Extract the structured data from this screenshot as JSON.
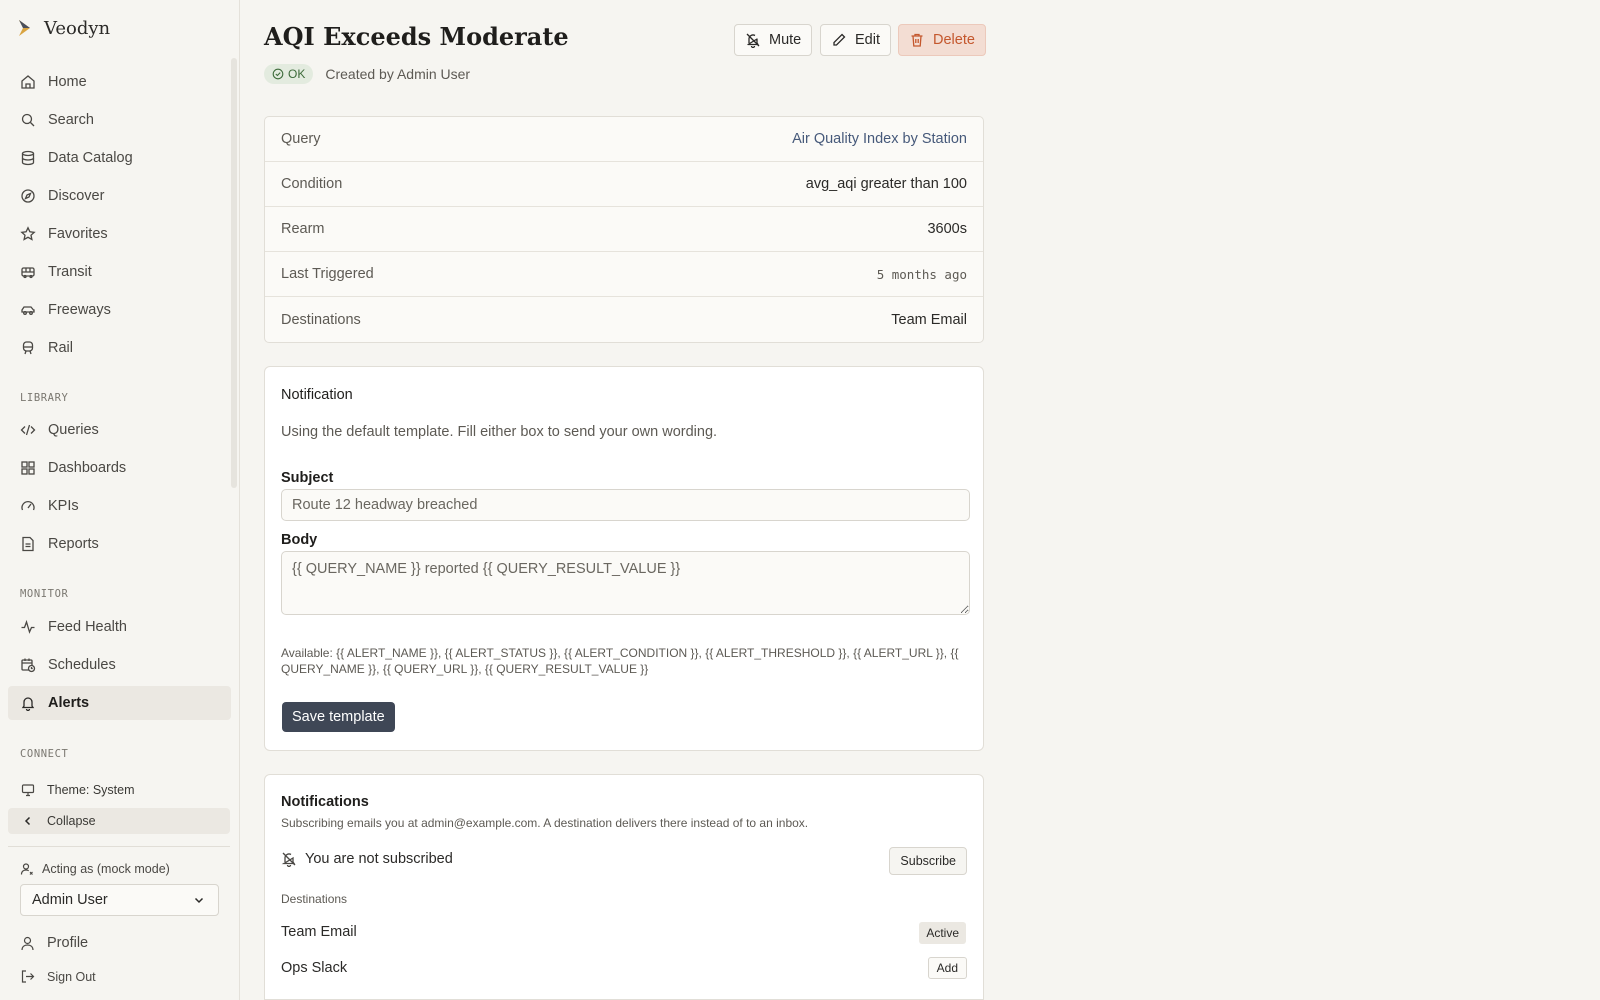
{
  "app": {
    "name": "Veodyn"
  },
  "sidebar": {
    "nav": [
      {
        "label": "Home",
        "icon": "home-icon"
      },
      {
        "label": "Search",
        "icon": "search-icon"
      },
      {
        "label": "Data Catalog",
        "icon": "database-icon"
      },
      {
        "label": "Discover",
        "icon": "compass-icon"
      },
      {
        "label": "Favorites",
        "icon": "star-icon"
      },
      {
        "label": "Transit",
        "icon": "bus-icon"
      },
      {
        "label": "Freeways",
        "icon": "car-icon"
      },
      {
        "label": "Rail",
        "icon": "train-icon"
      }
    ],
    "library_label": "LIBRARY",
    "library": [
      {
        "label": "Queries",
        "icon": "code-icon"
      },
      {
        "label": "Dashboards",
        "icon": "dashboard-icon"
      },
      {
        "label": "KPIs",
        "icon": "gauge-icon"
      },
      {
        "label": "Reports",
        "icon": "report-icon"
      }
    ],
    "monitor_label": "MONITOR",
    "monitor": [
      {
        "label": "Feed Health",
        "icon": "activity-icon"
      },
      {
        "label": "Schedules",
        "icon": "calendar-clock-icon"
      },
      {
        "label": "Alerts",
        "icon": "bell-icon",
        "active": true
      }
    ],
    "connect_label": "CONNECT",
    "theme": "Theme: System",
    "collapse": "Collapse",
    "acting_as": "Acting as (mock mode)",
    "acting_user": "Admin User",
    "profile": "Profile",
    "sign_out": "Sign Out"
  },
  "header": {
    "title": "AQI Exceeds Moderate",
    "status": "OK",
    "created_by": "Created by Admin User",
    "mute": "Mute",
    "edit": "Edit",
    "delete": "Delete"
  },
  "properties": [
    {
      "key": "Query",
      "value": "Air Quality Index by Station"
    },
    {
      "key": "Condition",
      "value": "avg_aqi greater than 100"
    },
    {
      "key": "Rearm",
      "value": "3600s"
    },
    {
      "key": "Last Triggered",
      "value": "5 months ago"
    },
    {
      "key": "Destinations",
      "value": "Team Email"
    }
  ],
  "template": {
    "title": "Notification",
    "note": "Using the default template. Fill either box to send your own wording.",
    "subject_label": "Subject",
    "subject_placeholder": "Route 12 headway breached",
    "body_label": "Body",
    "body_placeholder": "{{ QUERY_NAME }} reported {{ QUERY_RESULT_VALUE }}",
    "available_line1": "Available: {{ ALERT_NAME }}, {{ ALERT_STATUS }}, {{ ALERT_CONDITION }}, {{ ALERT_THRESHOLD }}, {{ ALERT_URL }}, {{",
    "available_line2": "QUERY_NAME }}, {{ QUERY_URL }}, {{ QUERY_RESULT_VALUE }}",
    "save": "Save template"
  },
  "notifications": {
    "title": "Notifications",
    "subtitle": "Subscribing emails you at admin@example.com. A destination delivers there instead of to an inbox.",
    "status": "You are not subscribed",
    "subscribe": "Subscribe",
    "destinations_label": "Destinations",
    "destinations": [
      {
        "name": "Team Email",
        "action": "Active"
      },
      {
        "name": "Ops Slack",
        "action": "Add"
      }
    ]
  }
}
